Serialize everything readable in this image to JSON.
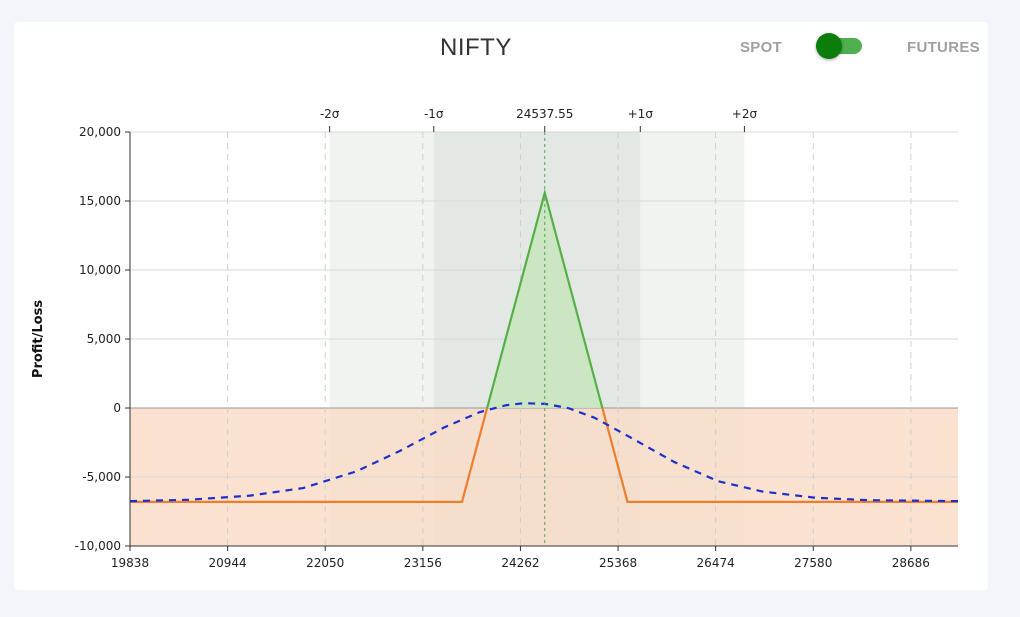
{
  "header": {
    "title": "NIFTY",
    "toggle": {
      "left_label": "SPOT",
      "right_label": "FUTURES",
      "state": "SPOT",
      "thumb_color": "#0a7d0a",
      "track_color": "#4fb04f"
    }
  },
  "chart_data": {
    "type": "line",
    "title": "NIFTY",
    "xlabel": "",
    "ylabel": "Profit/Loss",
    "xlim": [
      19838,
      29220
    ],
    "ylim": [
      -10000,
      20000
    ],
    "grid": true,
    "x_ticks": [
      19838,
      20944,
      22050,
      23156,
      24262,
      25368,
      26474,
      27580,
      28686
    ],
    "y_ticks": [
      -10000,
      -5000,
      0,
      5000,
      10000,
      15000,
      20000
    ],
    "y_tick_labels": [
      "-10,000",
      "-5,000",
      "0",
      "5,000",
      "10,000",
      "15,000",
      "20,000"
    ],
    "spot": {
      "value": 24537.55,
      "label": "24537.55"
    },
    "sigma_markers": [
      {
        "label": "-2σ",
        "x": 22100
      },
      {
        "label": "-1σ",
        "x": 23280
      },
      {
        "label": "+1σ",
        "x": 25620
      },
      {
        "label": "+2σ",
        "x": 26800
      }
    ],
    "bands": [
      {
        "name": "two_sigma",
        "from": 22100,
        "to": 26800,
        "color": "#f1f3f1"
      },
      {
        "name": "one_sigma",
        "from": 23280,
        "to": 25620,
        "color": "#e4e8e4"
      }
    ],
    "loss_zone_color": "#f9dcc8",
    "series": [
      {
        "role": "payoff_at_expiry",
        "style": "solid",
        "profit_color": "#55b046",
        "loss_color": "#ee7d2c",
        "profit_fill": "#c9e6bf",
        "x": [
          19838,
          23600,
          24537.55,
          25475,
          29220
        ],
        "y": [
          -6800,
          -6800,
          15600,
          -6800,
          -6800
        ]
      },
      {
        "role": "payoff_today",
        "style": "dashed",
        "color": "#1f2fcc",
        "x": [
          19838,
          20500,
          21200,
          21800,
          22400,
          22900,
          23400,
          23800,
          24100,
          24300,
          24537.55,
          24800,
          25100,
          25500,
          26000,
          26500,
          27000,
          27600,
          28200,
          29220
        ],
        "y": [
          -6750,
          -6650,
          -6350,
          -5800,
          -4600,
          -3100,
          -1400,
          -300,
          200,
          350,
          300,
          0,
          -700,
          -2100,
          -3900,
          -5300,
          -6050,
          -6500,
          -6680,
          -6750
        ]
      }
    ]
  }
}
